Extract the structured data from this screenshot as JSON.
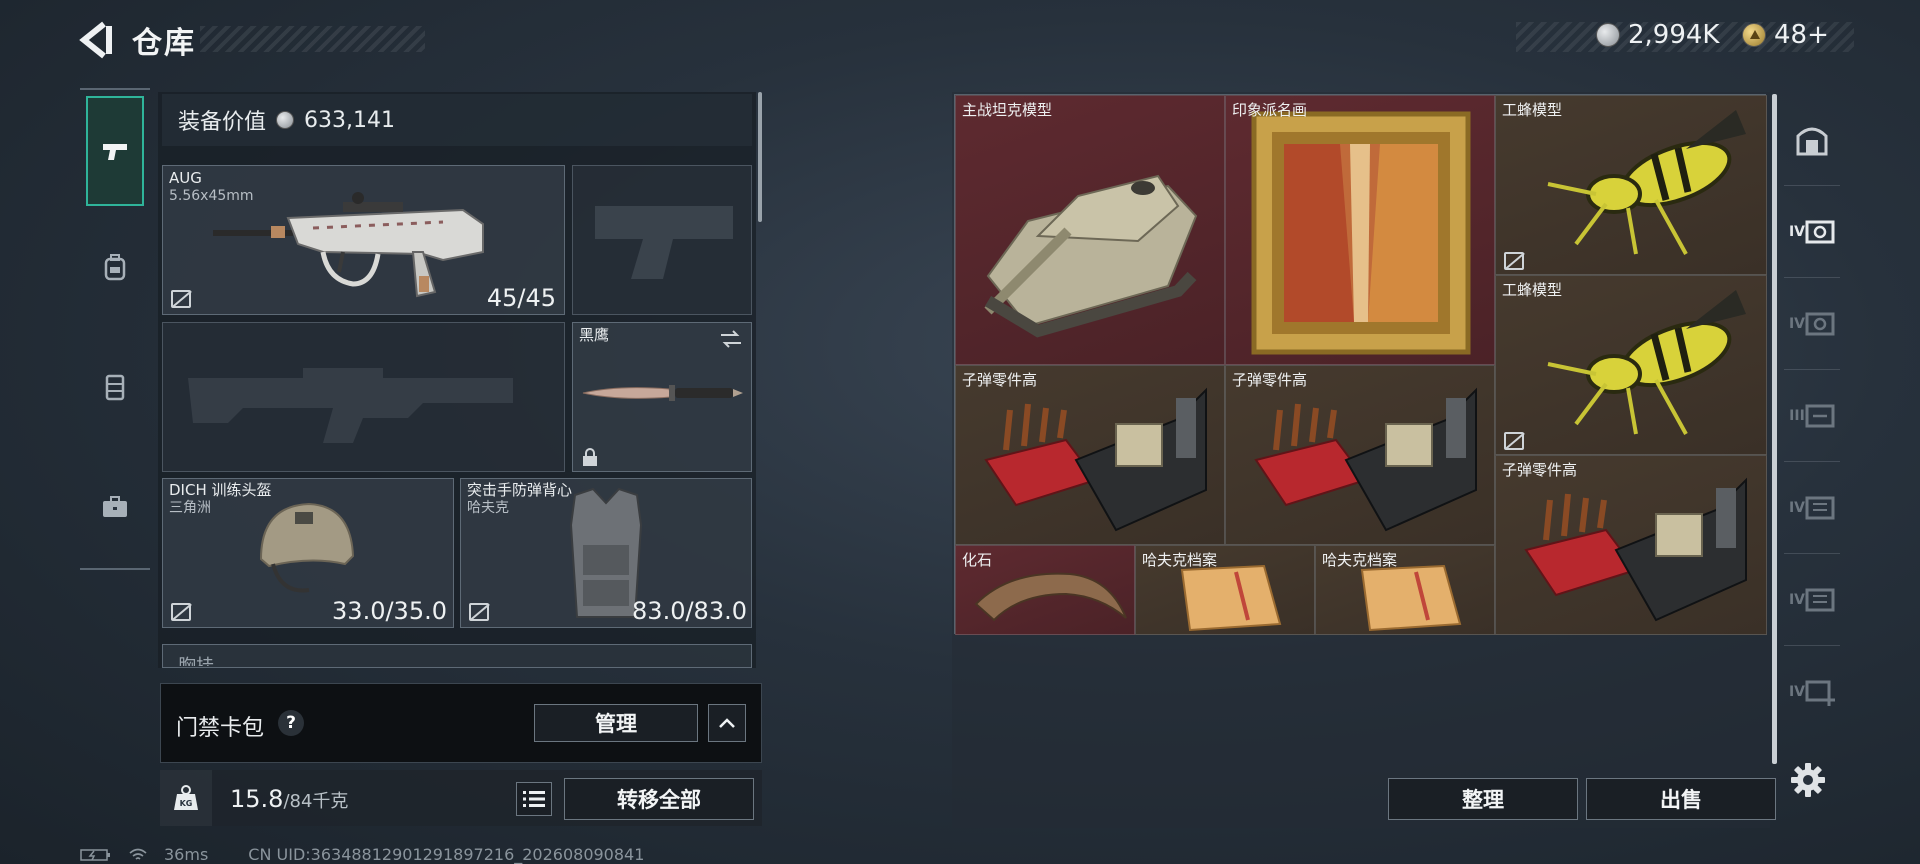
{
  "header": {
    "title": "仓库",
    "currency_silver": "2,994K",
    "currency_gold": "48+"
  },
  "left_rail": {
    "tabs": [
      {
        "icon": "pistol-icon",
        "active": true
      },
      {
        "icon": "backpack-icon",
        "active": false
      },
      {
        "icon": "chest-rig-icon",
        "active": false
      },
      {
        "icon": "briefcase-icon",
        "active": false
      }
    ]
  },
  "equipment": {
    "value_label": "装备价值",
    "value": "633,141",
    "primary_weapon": {
      "name": "AUG",
      "caliber": "5.56x45mm",
      "ammo": "45/45"
    },
    "melee": {
      "name": "黑鹰"
    },
    "helmet": {
      "name": "DICH 训练头盔",
      "faction": "三角洲",
      "durability": "33.0/35.0"
    },
    "armor": {
      "name": "突击手防弹背心",
      "faction": "哈夫克",
      "durability": "83.0/83.0"
    },
    "chest_rig_label": "胸挂"
  },
  "keycard": {
    "label": "门禁卡包",
    "help": "?",
    "manage": "管理"
  },
  "footer": {
    "weight_icon_text": "KG",
    "weight": "15.8",
    "weight_cap": "/84千克",
    "transfer_all": "转移全部",
    "ping": "36ms",
    "uid": "CN UID:363488129012918972​16_202608090841"
  },
  "storage": {
    "items": [
      {
        "name": "主战坦克模型",
        "color": "#5e2a30"
      },
      {
        "name": "印象派名画",
        "color": "#5e2a30"
      },
      {
        "name": "工蜂模型",
        "color": "#463a2e"
      },
      {
        "name": "工蜂模型",
        "color": "#463a2e"
      },
      {
        "name": "子弹零件高",
        "color": "#463a2e"
      },
      {
        "name": "子弹零件高",
        "color": "#463a2e"
      },
      {
        "name": "子弹零件高",
        "color": "#463a2e"
      },
      {
        "name": "化石",
        "color": "#5e2a30"
      },
      {
        "name": "哈夫克档案",
        "color": "#463a2e"
      },
      {
        "name": "哈夫克档案",
        "color": "#463a2e"
      }
    ],
    "tidy": "整理",
    "sell": "出售"
  },
  "container_rail": {
    "items": [
      {
        "glyph": "",
        "icon": "safe-box-icon"
      },
      {
        "glyph": "IV",
        "icon": "storage-box-icon",
        "active": true
      },
      {
        "glyph": "IV",
        "icon": "storage-box-icon"
      },
      {
        "glyph": "III",
        "icon": "storage-box-icon"
      },
      {
        "glyph": "IV",
        "icon": "storage-box-icon"
      },
      {
        "glyph": "IV",
        "icon": "storage-box-icon"
      },
      {
        "glyph": "IV",
        "icon": "add-box-icon"
      }
    ]
  }
}
